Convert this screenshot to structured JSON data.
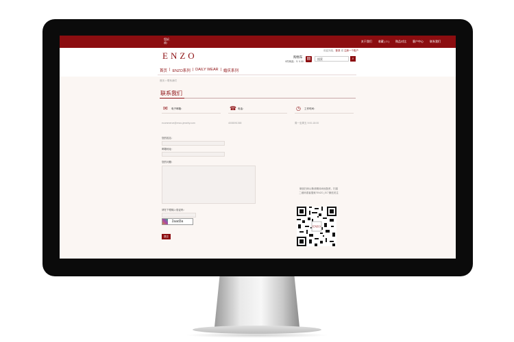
{
  "topbar": {
    "hello_line1": "您好,",
    "hello_line2": "欢!",
    "links": [
      "关于我们",
      "收藏 ( 0 )",
      "购品对比",
      "客户中心",
      "联系我们"
    ]
  },
  "header": {
    "logo": "ENZO",
    "login_prefix": "欢迎光临，",
    "login_link1": "登录",
    "login_mid": " 或 ",
    "login_link2": "注册一个账户",
    "cart_title": "购物车",
    "cart_sub": "0件商品 - ￥ 0.00",
    "search_placeholder": "搜索"
  },
  "nav": {
    "items": [
      "首页",
      "ENZO系列",
      "DAILY WEAR",
      "婚庆系列"
    ]
  },
  "breadcrumb": "首页 > 联系我们",
  "page": {
    "title": "联系我们",
    "email_label": "电子邮箱：",
    "email_value": "ecommerce@enzo-jewelry.com",
    "phone_label": "电话：",
    "phone_value": "4008091365",
    "hours_label": "工作时间：",
    "hours_value": "周一至周五 9:00-18:00"
  },
  "form": {
    "name_label": "您的姓名：",
    "email_label": "邮箱地址：",
    "message_label": "您的问题：",
    "captcha_label": "请在下框输入验证码：",
    "captcha_text": "2aad3a",
    "submit_label": "提交"
  },
  "qr": {
    "line1": "微信扫码以敬请期待尚优配资，扫描",
    "line2": "二维码或者搜索\"ENZO_EC\"微信关注"
  },
  "colors": {
    "brand": "#8c0d10",
    "content_bg": "#fbf6f3"
  }
}
